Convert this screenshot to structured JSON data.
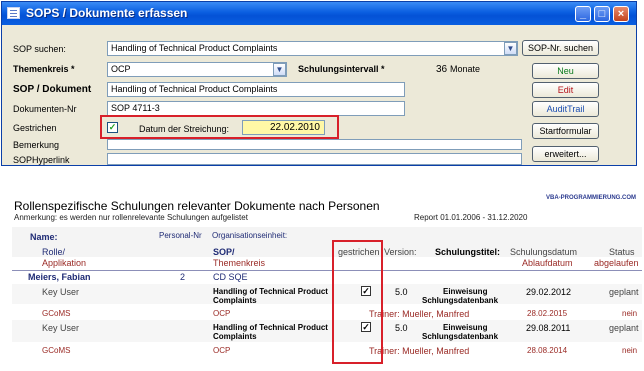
{
  "window": {
    "title": "SOPS / Dokumente erfassen",
    "buttons": {
      "minimize": "_",
      "maximize": "□",
      "close": "×"
    }
  },
  "form": {
    "sop_search_label": "SOP suchen:",
    "sop_search_value": "Handling of Technical Product Complaints",
    "sop_search_button": "SOP-Nr. suchen",
    "themenkreis_label": "Themenkreis *",
    "themenkreis_value": "OCP",
    "schulungsintervall_label": "Schulungsintervall *",
    "schulungsintervall_value": "36",
    "schulungsintervall_unit": "Monate",
    "sop_dokument_label": "SOP / Dokument",
    "sop_dokument_value": "Handling of Technical Product Complaints",
    "dokumenten_nr_label": "Dokumenten-Nr",
    "dokumenten_nr_value": "SOP 4711-3",
    "gestrichen_label": "Gestrichen",
    "gestrichen_checked": "✓",
    "datum_streichung_label": "Datum der Streichung:",
    "datum_streichung_value": "22.02.2010",
    "bemerkung_label": "Bemerkung",
    "sophyperlink_label": "SOPHyperlink",
    "buttons": {
      "neu": "Neu",
      "edit": "Edit",
      "audit_trail": "AuditTrail",
      "startformular": "Startformular",
      "erweitert": "erweitert..."
    }
  },
  "report": {
    "title": "Rollenspezifische Schulungen relevanter Dokumente nach Personen",
    "subtitle": "Anmerkung: es werden nur rollenrelevante Schulungen aufgelistet",
    "period": "Report 01.01.2006 - 31.12.2020",
    "brand": "VBA-PROGRAMMIERUNG.COM",
    "headers": {
      "name": "Name:",
      "personal_nr": "Personal-Nr",
      "organisationseinheit": "Organisationseinheit:",
      "rolle": "Rolle/",
      "applikation": "Applikation",
      "sop": "SOP/",
      "themenkreis": "Themenkreis",
      "gestrichen": "gestrichen",
      "version": "Version:",
      "schulungstitel": "Schulungstitel:",
      "schulungsdatum": "Schulungsdatum",
      "ablaufdatum": "Ablaufdatum",
      "status": "Status",
      "abgelaufen": "abgelaufen"
    },
    "person": {
      "name": "Meiers, Fabian",
      "personal_nr": "2",
      "org": "CD SQE"
    },
    "rows": [
      {
        "rolle": "Key User",
        "sop_line1": "Handling of Technical Product",
        "sop_line2": "Complaints",
        "gestrichen": "✓",
        "version": "5.0",
        "titel_line1": "Einweisung",
        "titel_line2": "Schlungsdatenbank",
        "schulungsdatum": "29.02.2012",
        "status": "geplant",
        "applikation": "GCoMS",
        "themenkreis": "OCP",
        "trainer": "Trainer: Mueller, Manfred",
        "ablaufdatum": "28.02.2015",
        "abgelaufen": "nein"
      },
      {
        "rolle": "Key User",
        "sop_line1": "Handling of Technical Product",
        "sop_line2": "Complaints",
        "gestrichen": "✓",
        "version": "5.0",
        "titel_line1": "Einweisung",
        "titel_line2": "Schlungsdatenbank",
        "schulungsdatum": "29.08.2011",
        "status": "geplant",
        "applikation": "GCoMS",
        "themenkreis": "OCP",
        "trainer": "Trainer: Mueller, Manfred",
        "ablaufdatum": "28.08.2014",
        "abgelaufen": "nein"
      }
    ]
  },
  "colors": {
    "titlebar": "#0a5ee0",
    "highlight_box": "#d8202a",
    "date_field": "#fff8a6",
    "report_header_navy": "#1f2b75",
    "report_header_maroon": "#9a2a25"
  }
}
